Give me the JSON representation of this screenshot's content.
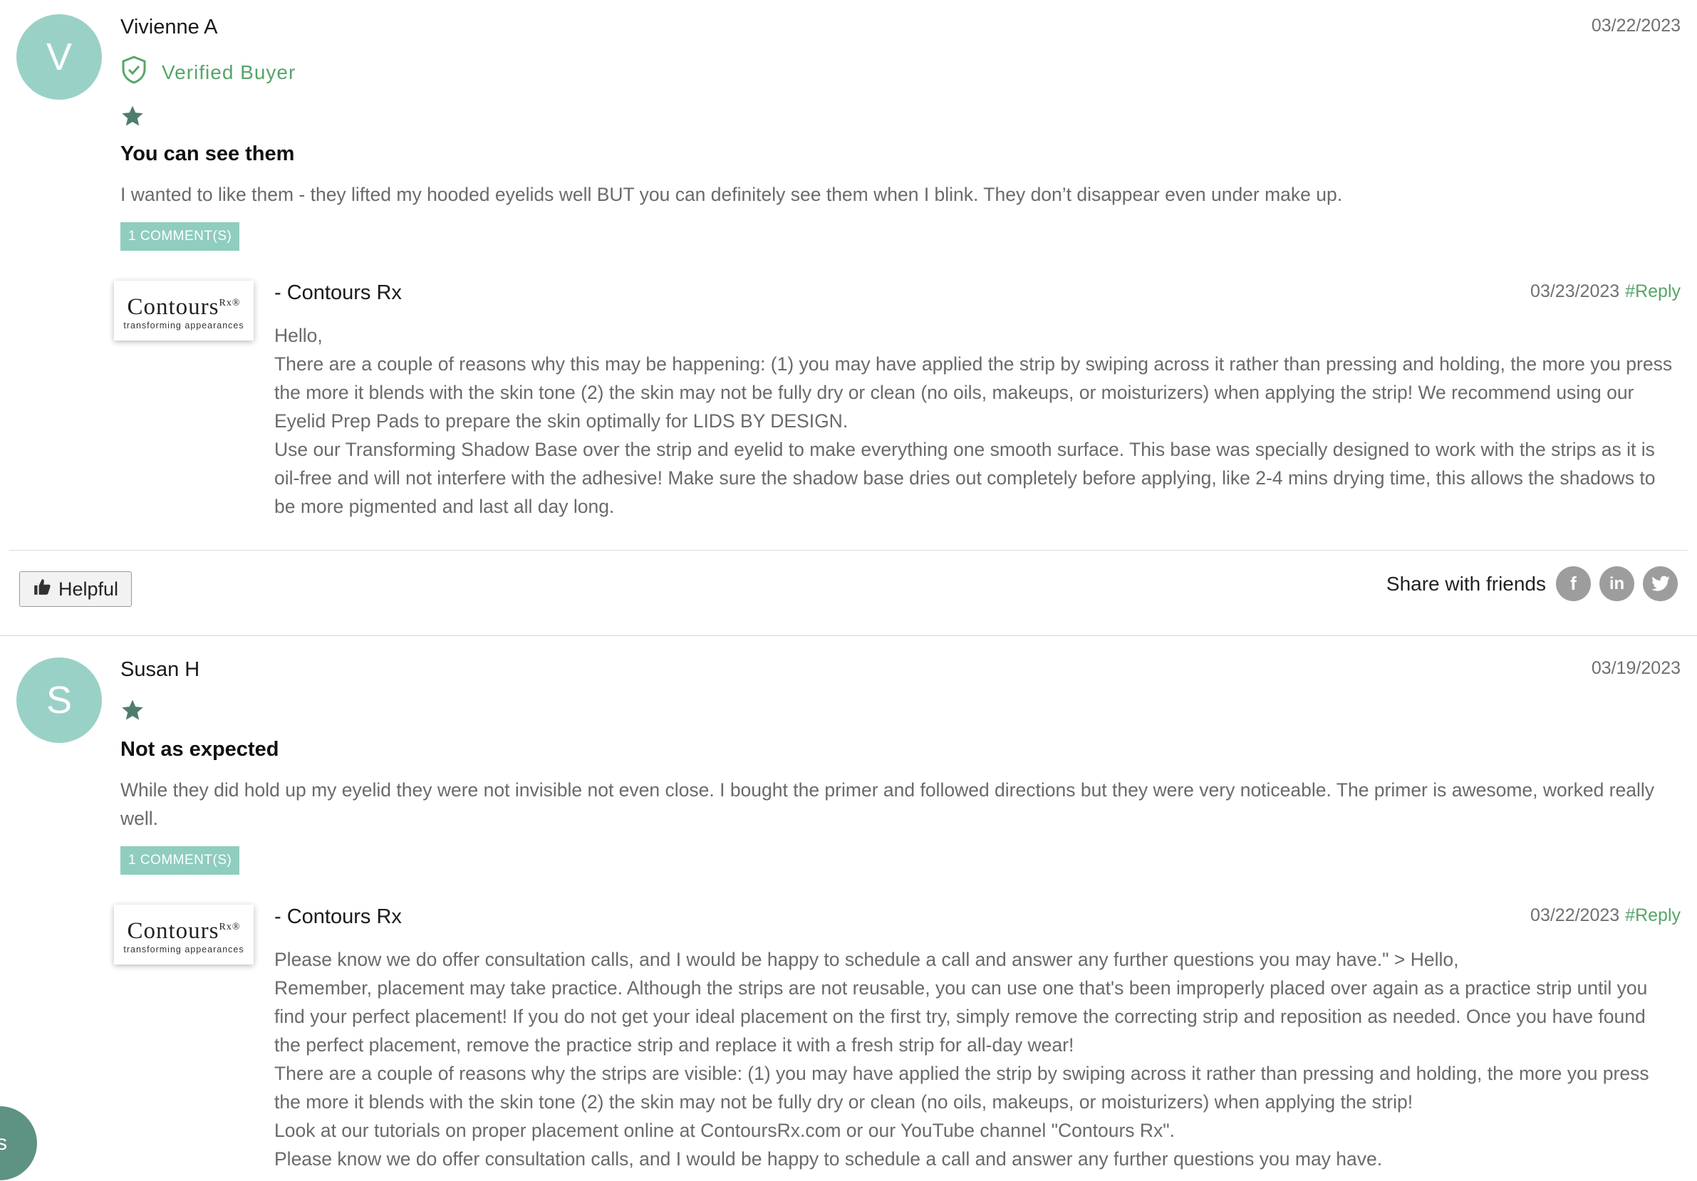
{
  "colors": {
    "accent_green": "#56a569",
    "avatar_teal": "#9ad1c6",
    "star_green": "#4d7d6e",
    "badge_teal": "#8fcdbf",
    "chat_bubble": "#5e9283"
  },
  "reviews": [
    {
      "avatar_letter": "V",
      "author": "Vivienne A",
      "date": "03/22/2023",
      "verified_label": "Verified Buyer",
      "rating": 1,
      "title": "You can see them",
      "body": "I wanted to like them - they lifted my hooded eyelids well BUT you can definitely see them when I blink. They don’t disappear even under make up.",
      "comments_label": "1 COMMENT(S)",
      "reply": {
        "logo_word": "Contours",
        "logo_sup": "Rx®",
        "logo_tagline": "transforming appearances",
        "author": "- Contours Rx",
        "date": "03/23/2023",
        "reply_link": "#Reply",
        "paragraphs": [
          "Hello,",
          "There are a couple of reasons why this may be happening: (1) you may have applied the strip by swiping across it rather than pressing and holding, the more you press the more it blends with the skin tone (2) the skin may not be fully dry or clean (no oils, makeups, or moisturizers) when applying the strip! We recommend using our Eyelid Prep Pads to prepare the skin optimally for LIDS BY DESIGN.",
          "Use our Transforming Shadow Base over the strip and eyelid to make everything one smooth surface. This base was specially designed to work with the strips as it is oil-free and will not interfere with the adhesive! Make sure the shadow base dries out completely before applying, like 2-4 mins drying time, this allows the shadows to be more pigmented and last all day long."
        ]
      },
      "helpful_label": "Helpful",
      "share_label": "Share with friends",
      "share_icons": [
        "facebook-icon",
        "linkedin-icon",
        "twitter-icon"
      ]
    },
    {
      "avatar_letter": "S",
      "author": "Susan H",
      "date": "03/19/2023",
      "rating": 1,
      "title": "Not as expected",
      "body": "While they did hold up my eyelid they were not invisible not even close. I bought the primer and followed directions but they were very noticeable. The primer is awesome, worked really well.",
      "comments_label": "1 COMMENT(S)",
      "reply": {
        "logo_word": "Contours",
        "logo_sup": "Rx®",
        "logo_tagline": "transforming appearances",
        "author": "- Contours Rx",
        "date": "03/22/2023",
        "reply_link": "#Reply",
        "paragraphs": [
          "Please know we do offer consultation calls, and I would be happy to schedule a call and answer any further questions you may have.\" > Hello,",
          "Remember, placement may take practice. Although the strips are not reusable, you can use one that's been improperly placed over again as a practice strip until you find your perfect placement! If you do not get your ideal placement on the first try, simply remove the correcting strip and reposition as needed. Once you have found the perfect placement, remove the practice strip and replace it with a fresh strip for all-day wear!",
          "There are a couple of reasons why the strips are visible: (1) you may have applied the strip by swiping across it rather than pressing and holding, the more you press the more it blends with the skin tone (2) the skin may not be fully dry or clean (no oils, makeups, or moisturizers) when applying the strip!",
          "Look at our tutorials on proper placement online at ContoursRx.com or our YouTube channel \"Contours Rx\".",
          "Please know we do offer consultation calls, and I would be happy to schedule a call and answer any further questions you may have."
        ]
      }
    }
  ],
  "chat_widget": {
    "label": "s"
  }
}
